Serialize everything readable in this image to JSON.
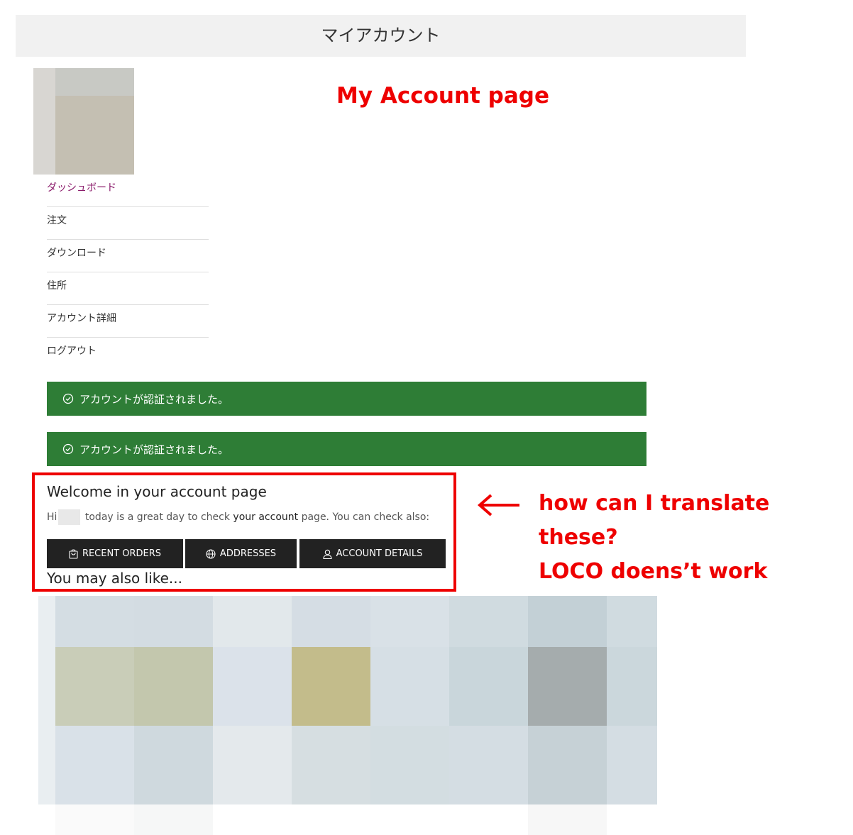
{
  "header": {
    "title": "マイアカウント"
  },
  "annotations": {
    "page_label": "My Account page",
    "question_line1": "how can I translate these?",
    "question_line2": "LOCO doens’t work",
    "arrow_glyph": "←"
  },
  "sidebar": {
    "items": [
      {
        "label": "ダッシュボード",
        "active": true
      },
      {
        "label": "注文",
        "active": false
      },
      {
        "label": "ダウンロード",
        "active": false
      },
      {
        "label": "住所",
        "active": false
      },
      {
        "label": "アカウント詳細",
        "active": false
      },
      {
        "label": "ログアウト",
        "active": false
      }
    ]
  },
  "notices": [
    {
      "text": "アカウントが認証されました。",
      "icon": "check-circle-icon"
    },
    {
      "text": "アカウントが認証されました。",
      "icon": "check-circle-icon"
    }
  ],
  "dashboard": {
    "welcome_title": "Welcome in your account page",
    "hi": "Hi",
    "text_middle": "today is a great day to check",
    "text_link": "your account",
    "text_end": "page. You can check also:",
    "buttons": [
      {
        "label": "RECENT ORDERS",
        "icon": "shopping-bag-icon"
      },
      {
        "label": "ADDRESSES",
        "icon": "globe-icon"
      },
      {
        "label": "ACCOUNT DETAILS",
        "icon": "user-icon"
      }
    ]
  },
  "related": {
    "title": "You may also like..."
  },
  "colors": {
    "notice_green": "#2e7d36",
    "annotation_red": "#ee0000",
    "active_nav": "#8a1a6a",
    "button_dark": "#222222"
  }
}
